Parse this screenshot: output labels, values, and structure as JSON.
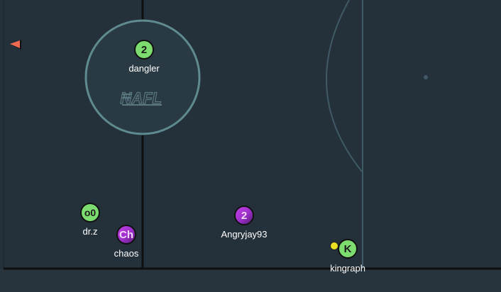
{
  "field": {
    "background_color": "#24313b",
    "line_color": "#0d0f10",
    "accent_line_color": "#3f5a64",
    "circle_color": "#5f8a8f",
    "logo_text": "NAFL"
  },
  "ball": {
    "color": "#e8e020"
  },
  "offscreen_indicator": {
    "color": "#f06a4f",
    "icon": "left-triangle-icon"
  },
  "players": [
    {
      "id": "dangler",
      "avatar": "2",
      "name": "dangler",
      "team": "green"
    },
    {
      "id": "drz",
      "avatar": "o0",
      "name": "dr.z",
      "team": "green"
    },
    {
      "id": "chaos",
      "avatar": "Ch",
      "name": "chaos",
      "team": "purple"
    },
    {
      "id": "angryjay",
      "avatar": "2",
      "name": "Angryjay93",
      "team": "purple"
    },
    {
      "id": "kingraph",
      "avatar": "K",
      "name": "kingraph",
      "team": "green"
    }
  ]
}
